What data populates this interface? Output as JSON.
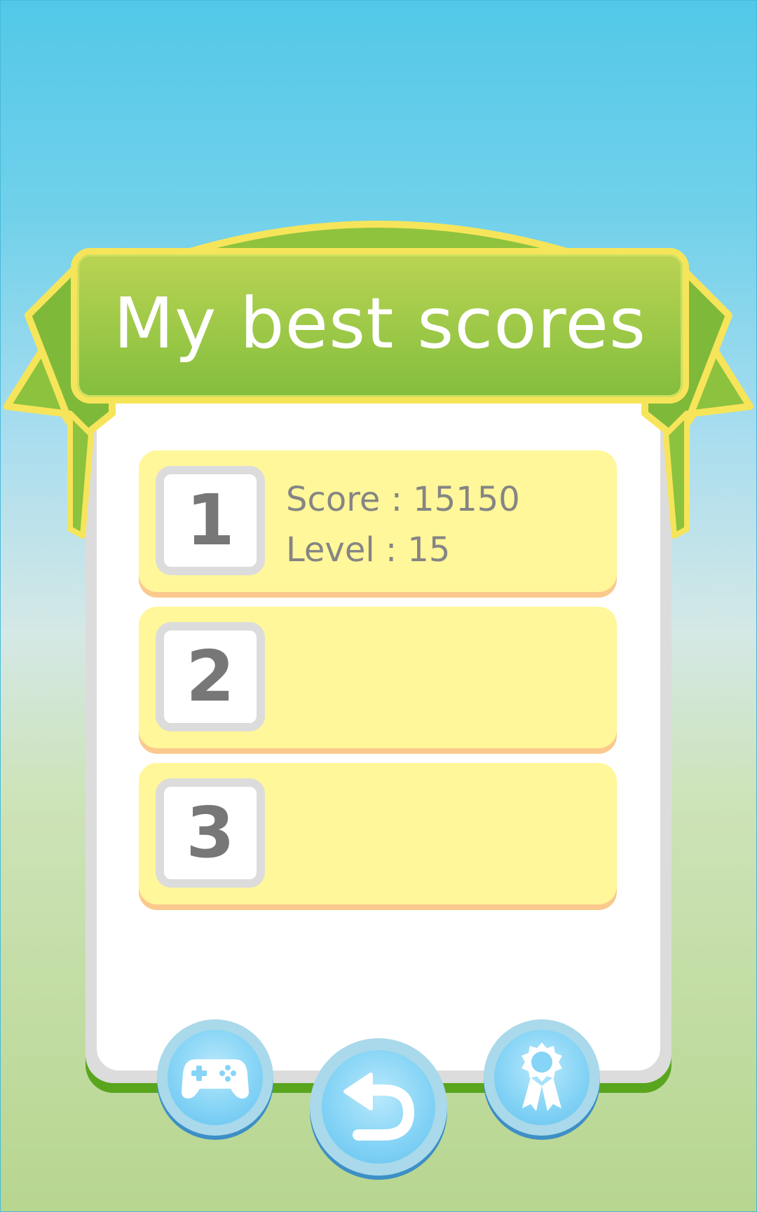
{
  "header": {
    "title": "My best scores"
  },
  "scores": [
    {
      "rank": "1",
      "score_line": "Score : 15150",
      "level_line": "Level : 15"
    },
    {
      "rank": "2",
      "score_line": "",
      "level_line": ""
    },
    {
      "rank": "3",
      "score_line": "",
      "level_line": ""
    }
  ],
  "buttons": [
    {
      "name": "games-button",
      "icon": "gamepad-icon"
    },
    {
      "name": "back-button",
      "icon": "undo-arrow-icon"
    },
    {
      "name": "achievements-button",
      "icon": "award-ribbon-icon"
    }
  ],
  "colors": {
    "ribbon_green": "#9cc847",
    "ribbon_border": "#f6e55a",
    "row_fill": "#fff799",
    "button_blue": "#86d4f6"
  }
}
